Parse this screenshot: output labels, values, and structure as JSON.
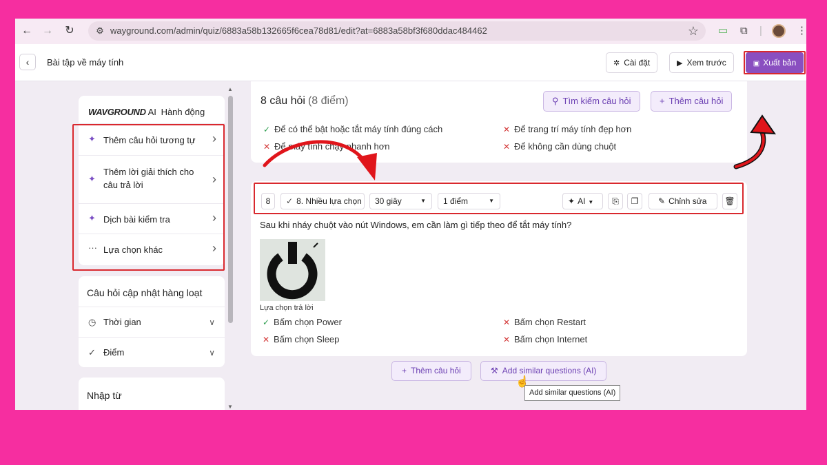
{
  "browser": {
    "url": "wayground.com/admin/quiz/6883a58b132665f6cea78d81/edit?at=6883a58bf3f680ddac484462"
  },
  "header": {
    "title": "Bài tập về máy tính",
    "settings_label": "Cài đặt",
    "preview_label": "Xem trước",
    "publish_label": "Xuất bản"
  },
  "sidebar": {
    "ai_brand": "WAVGROUND",
    "ai_suffix": "AI",
    "ai_title": "Hành động",
    "items": [
      {
        "label": "Thêm câu hỏi tương tự",
        "icon": "sparkle-icon"
      },
      {
        "label": "Thêm lời giải thích cho câu trả lời",
        "icon": "sparkle-icon"
      },
      {
        "label": "Dịch bài kiểm tra",
        "icon": "sparkle-icon"
      },
      {
        "label": "Lựa chọn khác",
        "icon": "ellipsis-icon"
      }
    ],
    "bulk_title": "Câu hỏi cập nhật hàng loạt",
    "bulk_items": [
      {
        "label": "Thời gian",
        "icon": "clock-icon"
      },
      {
        "label": "Điểm",
        "icon": "check-icon"
      }
    ],
    "import_title": "Nhập từ"
  },
  "main": {
    "question_count": "8 câu hỏi",
    "points_total": "(8 điểm)",
    "search_label": "Tìm kiếm câu hỏi",
    "add_label": "Thêm câu hỏi",
    "prev_answers": [
      {
        "text": "Để có thể bật hoặc tắt máy tính đúng cách",
        "correct": true
      },
      {
        "text": "Để trang trí máy tính đẹp hơn",
        "correct": false
      },
      {
        "text": "Để máy tính chạy nhanh hơn",
        "correct": false
      },
      {
        "text": "Để không cần dùng chuột",
        "correct": false
      }
    ],
    "question": {
      "number": "8",
      "type": "8. Nhiều lựa chọn",
      "time": "30 giây",
      "points": "1 điểm",
      "ai_label": "AI",
      "edit_label": "Chỉnh sửa",
      "text": "Sau khi nháy chuột vào nút Windows, em cần làm gì tiếp theo để tắt máy tính?",
      "image_caption": "Lựa chọn trả lời",
      "answers": [
        {
          "text": "Bấm chọn Power",
          "correct": true
        },
        {
          "text": "Bấm chọn Restart",
          "correct": false
        },
        {
          "text": "Bấm chọn Sleep",
          "correct": false
        },
        {
          "text": "Bấm chọn Internet",
          "correct": false
        }
      ]
    },
    "add_question_label": "Thêm câu hỏi",
    "add_similar_label": "Add similar questions (AI)",
    "tooltip": "Add similar questions (AI)"
  },
  "colors": {
    "background": "#f62ea0",
    "accent": "#8a4fc0",
    "highlight": "#d9282e",
    "correct": "#2e9e4f",
    "incorrect": "#d43b3b"
  }
}
